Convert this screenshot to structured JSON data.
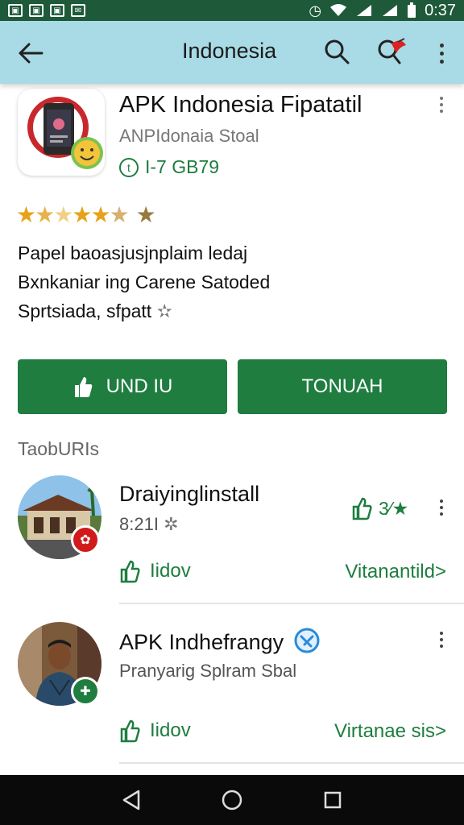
{
  "status_bar": {
    "left_icons": [
      "image-icon",
      "image-icon",
      "image-icon",
      "mail-icon"
    ],
    "time": "0:37"
  },
  "app_bar": {
    "title": "Indonesia",
    "back_icon": "arrow-left-icon",
    "search_icon": "search-icon",
    "extra_icon": "bird-search-icon",
    "more_icon": "more-vert-icon"
  },
  "app": {
    "title": "APK Indonesia Fipatatil",
    "subtitle": "ANPIdonaia Stoal",
    "meta_prefix": "t",
    "meta": "I-7 GB79",
    "rating_stars": 4.5,
    "description": [
      "Papel baoasjusjnplaim ledaj",
      "Bxnkaniar ing Carene Satoded",
      "Sprtsiada, sfpatt"
    ]
  },
  "buttons": {
    "install": "UND IU",
    "other": "TONUAH"
  },
  "section": {
    "title": "TaobURIs"
  },
  "list": [
    {
      "title": "Draiyinglinstall",
      "subtitle": "8:21I",
      "rating": "3⁄★",
      "action": "Iidov",
      "link": "Vitanantild>"
    },
    {
      "title": "APK Indhefrangy",
      "subtitle": "Pranyarig Splram Sbal",
      "action": "Iidov",
      "link": "Virtanae sis>"
    }
  ],
  "colors": {
    "accent": "#1e7d3f",
    "app_bar": "#a8dbe6",
    "status_bar": "#1e5a3a"
  }
}
